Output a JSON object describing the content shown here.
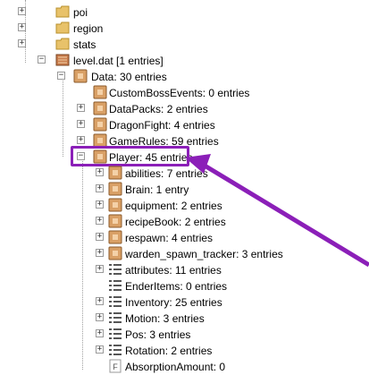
{
  "tree": {
    "folders": [
      {
        "label": "poi"
      },
      {
        "label": "region"
      },
      {
        "label": "stats"
      }
    ],
    "level": {
      "label": "level.dat [1 entries]"
    },
    "data": {
      "label": "Data: 30 entries"
    },
    "data_children": [
      {
        "label": "CustomBossEvents: 0 entries",
        "expander": ""
      },
      {
        "label": "DataPacks: 2 entries",
        "expander": "+"
      },
      {
        "label": "DragonFight: 4 entries",
        "expander": "+"
      },
      {
        "label": "GameRules: 59 entries",
        "expander": "+"
      },
      {
        "label": "Player: 45 entries",
        "expander": "-"
      }
    ],
    "player_children": [
      {
        "label": "abilities: 7 entries",
        "type": "compound",
        "expander": "+"
      },
      {
        "label": "Brain: 1 entry",
        "type": "compound",
        "expander": "+"
      },
      {
        "label": "equipment: 2 entries",
        "type": "compound",
        "expander": "+"
      },
      {
        "label": "recipeBook: 2 entries",
        "type": "compound",
        "expander": "+"
      },
      {
        "label": "respawn: 4 entries",
        "type": "compound",
        "expander": "+"
      },
      {
        "label": "warden_spawn_tracker: 3 entries",
        "type": "compound",
        "expander": "+"
      },
      {
        "label": "attributes: 11 entries",
        "type": "list",
        "expander": "+"
      },
      {
        "label": "EnderItems: 0 entries",
        "type": "list",
        "expander": ""
      },
      {
        "label": "Inventory: 25 entries",
        "type": "list",
        "expander": "+"
      },
      {
        "label": "Motion: 3 entries",
        "type": "list",
        "expander": "+"
      },
      {
        "label": "Pos: 3 entries",
        "type": "list",
        "expander": "+"
      },
      {
        "label": "Rotation: 2 entries",
        "type": "list",
        "expander": "+"
      },
      {
        "label": "AbsorptionAmount: 0",
        "type": "float",
        "expander": ""
      }
    ]
  },
  "annotation": {
    "color": "#8b1fb8",
    "highlight": "Player: 45 entries"
  },
  "colors": {
    "folder": "#e8c26a",
    "compound": "#d9a066",
    "list": "#555555"
  }
}
